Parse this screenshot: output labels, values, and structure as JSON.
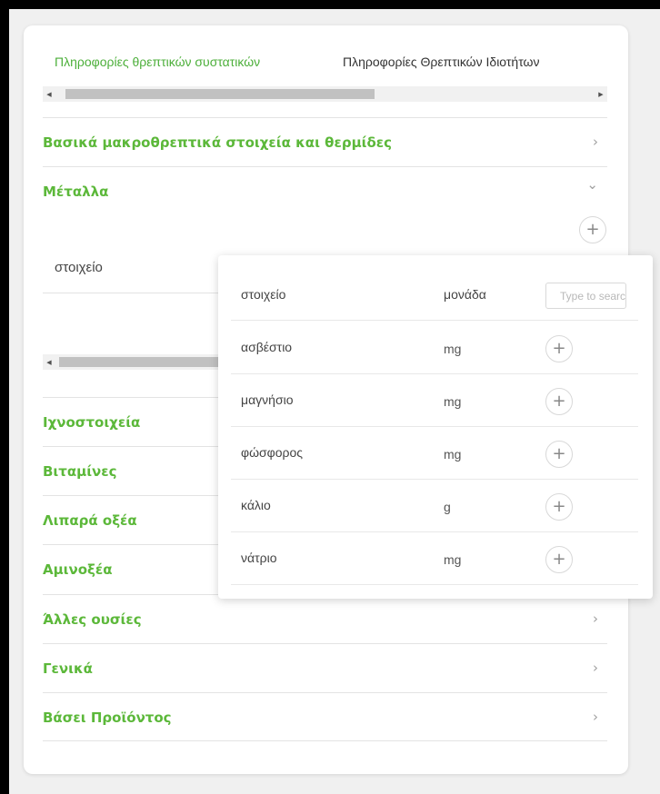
{
  "tabs": [
    {
      "label": "Πληροφορίες θρεπτικών συστατικών",
      "active": true
    },
    {
      "label": "Πληροφορίες Θρεπτικών Ιδιοτήτων",
      "active": false
    }
  ],
  "sections": [
    {
      "title": "Βασικά μακροθρεπτικά στοιχεία και θερμίδες",
      "chevron": "chevron-right-icon"
    },
    {
      "title": "Μέταλλα",
      "chevron": "chevron-down-icon"
    },
    {
      "title": "Ιχνοστοιχεία",
      "chevron": "chevron-right-icon"
    },
    {
      "title": "Βιταμίνες",
      "chevron": "chevron-right-icon"
    },
    {
      "title": "Λιπαρά οξέα",
      "chevron": "chevron-right-icon"
    },
    {
      "title": "Αμινοξέα",
      "chevron": "chevron-right-icon"
    },
    {
      "title": "Άλλες ουσίες",
      "chevron": "chevron-right-icon"
    },
    {
      "title": "Γενικά",
      "chevron": "chevron-right-icon"
    },
    {
      "title": "Βάσει Προϊόντος",
      "chevron": "chevron-right-icon"
    }
  ],
  "minerals_table": {
    "header": "στοιχείο",
    "add_icon": "plus-icon"
  },
  "popover": {
    "col_element": "στοιχείο",
    "col_unit": "μονάδα",
    "search_placeholder": "Type to search",
    "rows": [
      {
        "element": "ασβέστιο",
        "unit": "mg"
      },
      {
        "element": "μαγνήσιο",
        "unit": "mg"
      },
      {
        "element": "φώσφορος",
        "unit": "mg"
      },
      {
        "element": "κάλιο",
        "unit": "g"
      },
      {
        "element": "νάτριο",
        "unit": "mg"
      }
    ]
  },
  "icons": {
    "plus": "+",
    "chevron_right": "›",
    "chevron_down": "⌄",
    "scroll_left": "◀",
    "scroll_right": "▶"
  },
  "colors": {
    "accent_green": "#5cb83a",
    "tab_active": "#4caf3a"
  }
}
